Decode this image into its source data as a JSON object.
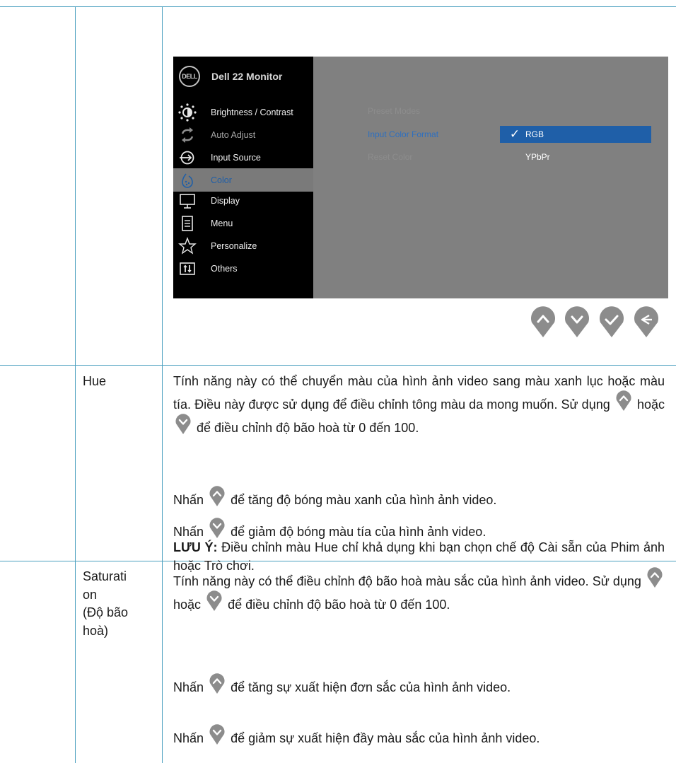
{
  "osd": {
    "title": "Dell 22 Monitor",
    "logo_text": "DELL",
    "menu": [
      {
        "label": "Brightness / Contrast",
        "icon": "brightness-icon",
        "state": "normal"
      },
      {
        "label": "Auto Adjust",
        "icon": "auto-adjust-icon",
        "state": "dim"
      },
      {
        "label": "Input Source",
        "icon": "input-source-icon",
        "state": "normal"
      },
      {
        "label": "Color",
        "icon": "color-icon",
        "state": "active"
      },
      {
        "label": "Display",
        "icon": "display-icon",
        "state": "normal"
      },
      {
        "label": "Menu",
        "icon": "menu-icon",
        "state": "normal"
      },
      {
        "label": "Personalize",
        "icon": "personalize-icon",
        "state": "normal"
      },
      {
        "label": "Others",
        "icon": "others-icon",
        "state": "normal"
      }
    ],
    "submenu": [
      {
        "label": "Preset Modes",
        "state": "dim"
      },
      {
        "label": "Input Color Format",
        "state": "selected"
      },
      {
        "label": "Reset Color",
        "state": "dim"
      }
    ],
    "options": [
      {
        "label": "RGB",
        "checked": true
      },
      {
        "label": "YPbPr",
        "checked": false
      }
    ],
    "nav_buttons": [
      "up-icon",
      "down-icon",
      "check-icon",
      "back-icon"
    ],
    "colors": {
      "highlight": "#1f5fa8",
      "panel": "#808080",
      "sidebar": "#000000"
    }
  },
  "rows": [
    {
      "label": "Hue",
      "p1_a": "Tính năng này có thể chuyển màu của hình ảnh video sang màu xanh lục hoặc màu tía. Điều này được sử dụng để điều chỉnh tông màu da mong muốn. Sử dụng",
      "p1_or": "hoặc",
      "p1_b": "để điều chỉnh độ bão hoà từ 0 đến 100.",
      "p2_a": "Nhấn",
      "p2_b": "để tăng độ bóng màu xanh của hình ảnh video.",
      "p3_a": "Nhấn",
      "p3_b": "để giảm độ bóng màu tía của hình ảnh video.",
      "note_label": "LƯU Ý:",
      "note_text": " Điều chỉnh màu Hue chỉ khả dụng khi bạn chọn chế độ Cài sẵn của Phim ảnh hoặc Trò chơi."
    },
    {
      "label_l1": "Saturati",
      "label_l2": "on",
      "label_l3": "(Độ bão",
      "label_l4": "hoà)",
      "p1_a": "Tính năng này có thể điều chỉnh độ bão hoà màu sắc của hình ảnh video. Sử dụng",
      "p1_or": "hoặc",
      "p1_b": "để điều chỉnh độ bão hoà từ 0 đến 100.",
      "p2_a": "Nhấn",
      "p2_b": "để tăng sự xuất hiện đơn sắc của hình ảnh video.",
      "p3_a": "Nhấn",
      "p3_b": "để giảm sự xuất hiện đầy màu sắc của hình ảnh video."
    }
  ]
}
